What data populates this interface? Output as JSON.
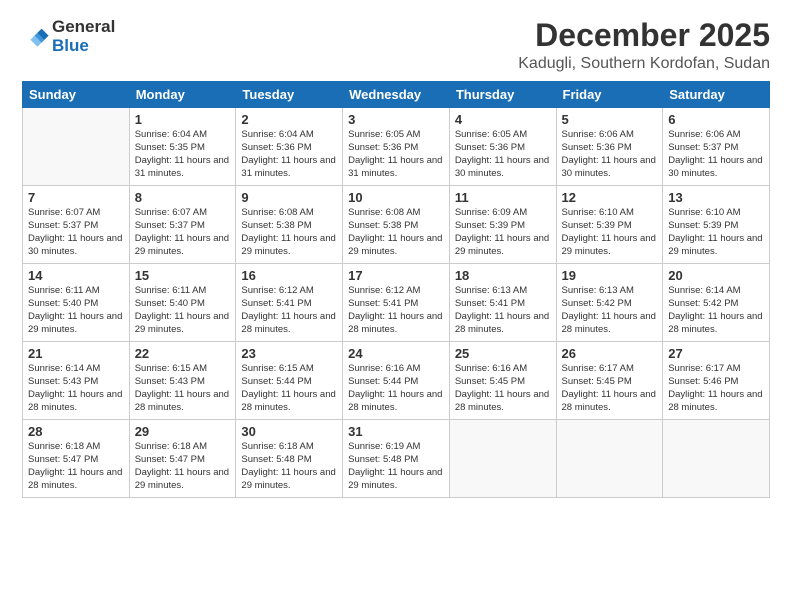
{
  "header": {
    "logo_line1": "General",
    "logo_line2": "Blue",
    "month_title": "December 2025",
    "location": "Kadugli, Southern Kordofan, Sudan"
  },
  "weekdays": [
    "Sunday",
    "Monday",
    "Tuesday",
    "Wednesday",
    "Thursday",
    "Friday",
    "Saturday"
  ],
  "weeks": [
    [
      {
        "day": "",
        "sunrise": "",
        "sunset": "",
        "daylight": "",
        "empty": true
      },
      {
        "day": "1",
        "sunrise": "Sunrise: 6:04 AM",
        "sunset": "Sunset: 5:35 PM",
        "daylight": "Daylight: 11 hours and 31 minutes."
      },
      {
        "day": "2",
        "sunrise": "Sunrise: 6:04 AM",
        "sunset": "Sunset: 5:36 PM",
        "daylight": "Daylight: 11 hours and 31 minutes."
      },
      {
        "day": "3",
        "sunrise": "Sunrise: 6:05 AM",
        "sunset": "Sunset: 5:36 PM",
        "daylight": "Daylight: 11 hours and 31 minutes."
      },
      {
        "day": "4",
        "sunrise": "Sunrise: 6:05 AM",
        "sunset": "Sunset: 5:36 PM",
        "daylight": "Daylight: 11 hours and 30 minutes."
      },
      {
        "day": "5",
        "sunrise": "Sunrise: 6:06 AM",
        "sunset": "Sunset: 5:36 PM",
        "daylight": "Daylight: 11 hours and 30 minutes."
      },
      {
        "day": "6",
        "sunrise": "Sunrise: 6:06 AM",
        "sunset": "Sunset: 5:37 PM",
        "daylight": "Daylight: 11 hours and 30 minutes."
      }
    ],
    [
      {
        "day": "7",
        "sunrise": "Sunrise: 6:07 AM",
        "sunset": "Sunset: 5:37 PM",
        "daylight": "Daylight: 11 hours and 30 minutes."
      },
      {
        "day": "8",
        "sunrise": "Sunrise: 6:07 AM",
        "sunset": "Sunset: 5:37 PM",
        "daylight": "Daylight: 11 hours and 29 minutes."
      },
      {
        "day": "9",
        "sunrise": "Sunrise: 6:08 AM",
        "sunset": "Sunset: 5:38 PM",
        "daylight": "Daylight: 11 hours and 29 minutes."
      },
      {
        "day": "10",
        "sunrise": "Sunrise: 6:08 AM",
        "sunset": "Sunset: 5:38 PM",
        "daylight": "Daylight: 11 hours and 29 minutes."
      },
      {
        "day": "11",
        "sunrise": "Sunrise: 6:09 AM",
        "sunset": "Sunset: 5:39 PM",
        "daylight": "Daylight: 11 hours and 29 minutes."
      },
      {
        "day": "12",
        "sunrise": "Sunrise: 6:10 AM",
        "sunset": "Sunset: 5:39 PM",
        "daylight": "Daylight: 11 hours and 29 minutes."
      },
      {
        "day": "13",
        "sunrise": "Sunrise: 6:10 AM",
        "sunset": "Sunset: 5:39 PM",
        "daylight": "Daylight: 11 hours and 29 minutes."
      }
    ],
    [
      {
        "day": "14",
        "sunrise": "Sunrise: 6:11 AM",
        "sunset": "Sunset: 5:40 PM",
        "daylight": "Daylight: 11 hours and 29 minutes."
      },
      {
        "day": "15",
        "sunrise": "Sunrise: 6:11 AM",
        "sunset": "Sunset: 5:40 PM",
        "daylight": "Daylight: 11 hours and 29 minutes."
      },
      {
        "day": "16",
        "sunrise": "Sunrise: 6:12 AM",
        "sunset": "Sunset: 5:41 PM",
        "daylight": "Daylight: 11 hours and 28 minutes."
      },
      {
        "day": "17",
        "sunrise": "Sunrise: 6:12 AM",
        "sunset": "Sunset: 5:41 PM",
        "daylight": "Daylight: 11 hours and 28 minutes."
      },
      {
        "day": "18",
        "sunrise": "Sunrise: 6:13 AM",
        "sunset": "Sunset: 5:41 PM",
        "daylight": "Daylight: 11 hours and 28 minutes."
      },
      {
        "day": "19",
        "sunrise": "Sunrise: 6:13 AM",
        "sunset": "Sunset: 5:42 PM",
        "daylight": "Daylight: 11 hours and 28 minutes."
      },
      {
        "day": "20",
        "sunrise": "Sunrise: 6:14 AM",
        "sunset": "Sunset: 5:42 PM",
        "daylight": "Daylight: 11 hours and 28 minutes."
      }
    ],
    [
      {
        "day": "21",
        "sunrise": "Sunrise: 6:14 AM",
        "sunset": "Sunset: 5:43 PM",
        "daylight": "Daylight: 11 hours and 28 minutes."
      },
      {
        "day": "22",
        "sunrise": "Sunrise: 6:15 AM",
        "sunset": "Sunset: 5:43 PM",
        "daylight": "Daylight: 11 hours and 28 minutes."
      },
      {
        "day": "23",
        "sunrise": "Sunrise: 6:15 AM",
        "sunset": "Sunset: 5:44 PM",
        "daylight": "Daylight: 11 hours and 28 minutes."
      },
      {
        "day": "24",
        "sunrise": "Sunrise: 6:16 AM",
        "sunset": "Sunset: 5:44 PM",
        "daylight": "Daylight: 11 hours and 28 minutes."
      },
      {
        "day": "25",
        "sunrise": "Sunrise: 6:16 AM",
        "sunset": "Sunset: 5:45 PM",
        "daylight": "Daylight: 11 hours and 28 minutes."
      },
      {
        "day": "26",
        "sunrise": "Sunrise: 6:17 AM",
        "sunset": "Sunset: 5:45 PM",
        "daylight": "Daylight: 11 hours and 28 minutes."
      },
      {
        "day": "27",
        "sunrise": "Sunrise: 6:17 AM",
        "sunset": "Sunset: 5:46 PM",
        "daylight": "Daylight: 11 hours and 28 minutes."
      }
    ],
    [
      {
        "day": "28",
        "sunrise": "Sunrise: 6:18 AM",
        "sunset": "Sunset: 5:47 PM",
        "daylight": "Daylight: 11 hours and 28 minutes."
      },
      {
        "day": "29",
        "sunrise": "Sunrise: 6:18 AM",
        "sunset": "Sunset: 5:47 PM",
        "daylight": "Daylight: 11 hours and 29 minutes."
      },
      {
        "day": "30",
        "sunrise": "Sunrise: 6:18 AM",
        "sunset": "Sunset: 5:48 PM",
        "daylight": "Daylight: 11 hours and 29 minutes."
      },
      {
        "day": "31",
        "sunrise": "Sunrise: 6:19 AM",
        "sunset": "Sunset: 5:48 PM",
        "daylight": "Daylight: 11 hours and 29 minutes."
      },
      {
        "day": "",
        "sunrise": "",
        "sunset": "",
        "daylight": "",
        "empty": true
      },
      {
        "day": "",
        "sunrise": "",
        "sunset": "",
        "daylight": "",
        "empty": true
      },
      {
        "day": "",
        "sunrise": "",
        "sunset": "",
        "daylight": "",
        "empty": true
      }
    ]
  ]
}
